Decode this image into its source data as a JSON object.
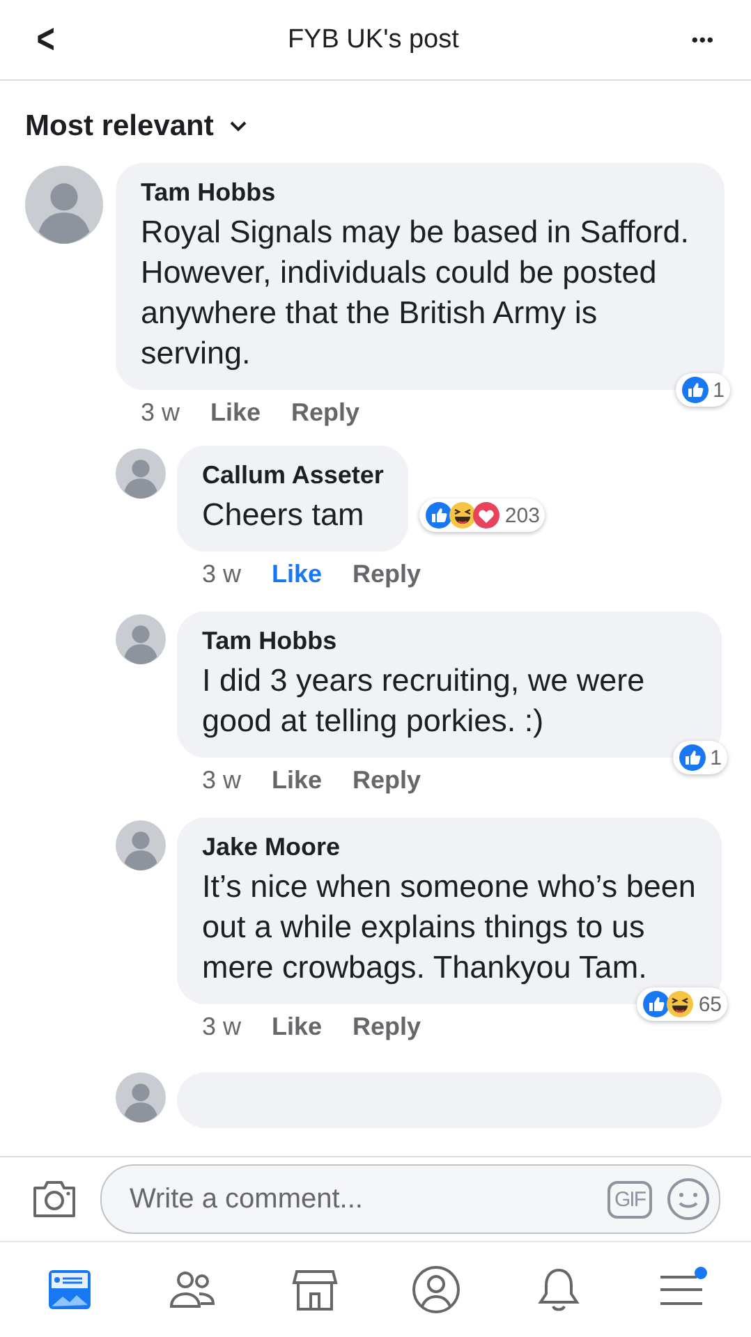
{
  "header": {
    "back": "<",
    "title": "FYB UK's post",
    "more": "•••"
  },
  "sort": {
    "label": "Most relevant"
  },
  "comments": [
    {
      "author": "Tam Hobbs",
      "text": "Royal Signals may be based in Safford. However, individuals could be posted anywhere that the British Army is serving.",
      "time": "3 w",
      "like": "Like",
      "liked": false,
      "reply": "Reply",
      "reactions": [
        {
          "kind": "like"
        }
      ],
      "count": "1",
      "children": [
        {
          "author": "Callum Asseter",
          "text": "Cheers tam",
          "time": "3 w",
          "like": "Like",
          "liked": true,
          "reply": "Reply",
          "reactions": [
            {
              "kind": "like"
            },
            {
              "kind": "haha"
            },
            {
              "kind": "love"
            }
          ],
          "count": "203",
          "inline": true
        },
        {
          "author": "Tam Hobbs",
          "text": "I did 3 years recruiting, we were good at telling porkies. :)",
          "time": "3 w",
          "like": "Like",
          "liked": false,
          "reply": "Reply",
          "reactions": [
            {
              "kind": "like"
            }
          ],
          "count": "1"
        },
        {
          "author": "Jake Moore",
          "text": "It’s nice when someone who’s been out a while explains things to us mere crowbags. Thankyou Tam.",
          "time": "3 w",
          "like": "Like",
          "liked": false,
          "reply": "Reply",
          "reactions": [
            {
              "kind": "like"
            },
            {
              "kind": "haha"
            }
          ],
          "count": "65"
        }
      ]
    }
  ],
  "composer": {
    "placeholder": "Write a comment...",
    "gif": "GIF"
  }
}
